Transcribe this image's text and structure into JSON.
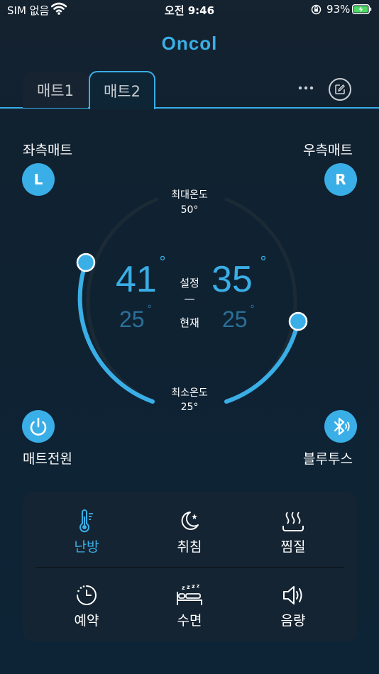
{
  "status_bar": {
    "carrier": "SIM 없음",
    "time": "오전 9:46",
    "battery_percent": "93%"
  },
  "header": {
    "brand": "Oncol"
  },
  "tabs": [
    {
      "label": "매트1",
      "active": false
    },
    {
      "label": "매트2",
      "active": true
    }
  ],
  "mats": {
    "left": {
      "title": "좌측매트",
      "badge": "L",
      "set_temp": "41",
      "current_temp": "25"
    },
    "right": {
      "title": "우측매트",
      "badge": "R",
      "set_temp": "35",
      "current_temp": "25"
    }
  },
  "dial": {
    "max_label": "최대온도",
    "max_value": "50°",
    "min_label": "최소온도",
    "min_value": "25°",
    "set_label": "설정",
    "separator": "—",
    "current_label": "현재",
    "degree_symbol": "°"
  },
  "controls": {
    "power_label": "매트전원",
    "bluetooth_label": "블루투스"
  },
  "modes": [
    {
      "label": "난방",
      "icon": "thermometer-icon",
      "active": true
    },
    {
      "label": "취침",
      "icon": "moon-icon",
      "active": false
    },
    {
      "label": "찜질",
      "icon": "steam-icon",
      "active": false
    },
    {
      "label": "예약",
      "icon": "timer-icon",
      "active": false
    },
    {
      "label": "수면",
      "icon": "sleep-bed-icon",
      "active": false
    },
    {
      "label": "음량",
      "icon": "speaker-icon",
      "active": false
    }
  ],
  "colors": {
    "accent": "#3aaee6",
    "background": "#0d2436",
    "panel": "#152432",
    "dim_temp": "#2c6f98"
  }
}
